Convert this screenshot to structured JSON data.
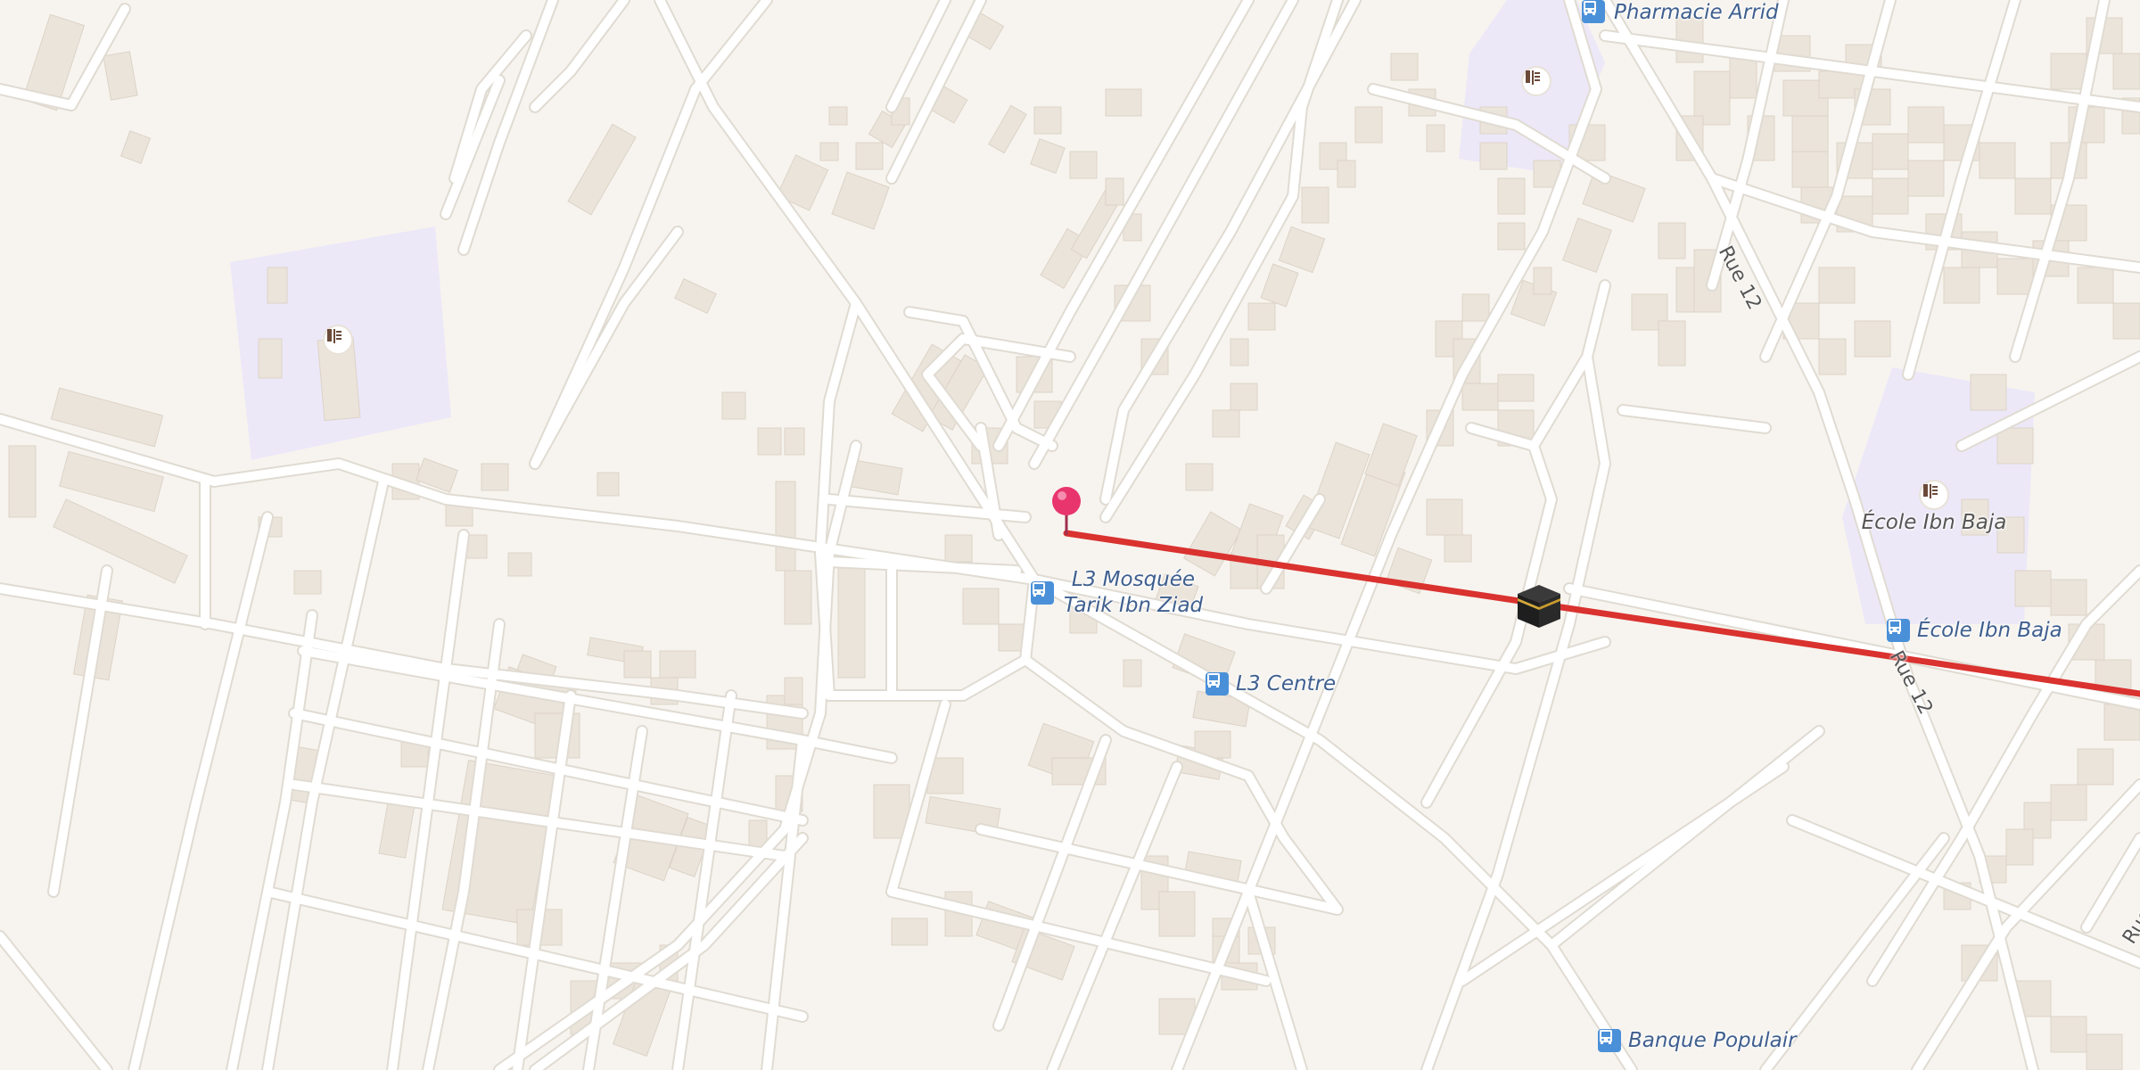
{
  "map": {
    "colors": {
      "land": "#f7f4ef",
      "road": "#ffffff",
      "road_casing": "#e0dbd2",
      "building": "#ebe4db",
      "school_zone": "#ece8f8",
      "route": "#d9322f",
      "bus_stop": "#4a90d9",
      "pin": "#e8356d"
    },
    "bus_stops": [
      {
        "name": "Pharmacie Arrid",
        "icon": "bus-icon"
      },
      {
        "name": "L3 Mosquée",
        "name_line2": "Tarik Ibn Ziad",
        "icon": "bus-icon"
      },
      {
        "name": "L3 Centre",
        "icon": "bus-icon"
      },
      {
        "name": "École Ibn Baja",
        "icon": "bus-icon"
      },
      {
        "name": "Banque Populair",
        "icon": "bus-icon"
      }
    ],
    "pois": [
      {
        "name": "École Ibn Baja",
        "icon": "school-icon"
      },
      {
        "name": "",
        "icon": "school-icon"
      },
      {
        "name": "",
        "icon": "school-icon"
      }
    ],
    "streets": [
      {
        "name": "Rue 12"
      },
      {
        "name": "Rue 12"
      },
      {
        "name": "Rue"
      }
    ],
    "markers": {
      "origin": {
        "icon": "location-pin-icon"
      },
      "destination": {
        "icon": "kaaba-icon"
      }
    },
    "route": {
      "type": "qibla-direction-line"
    }
  }
}
